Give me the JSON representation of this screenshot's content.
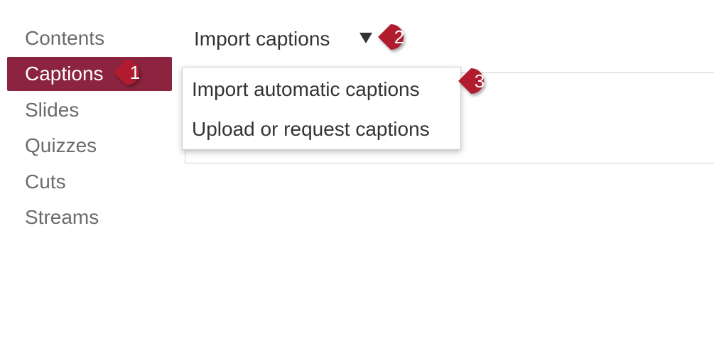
{
  "sidebar": {
    "items": [
      {
        "label": "Contents"
      },
      {
        "label": "Captions"
      },
      {
        "label": "Slides"
      },
      {
        "label": "Quizzes"
      },
      {
        "label": "Cuts"
      },
      {
        "label": "Streams"
      }
    ]
  },
  "header": {
    "import_label": "Import captions",
    "caret_icon": "caret-down-icon"
  },
  "dropdown": {
    "items": [
      {
        "label": "Import automatic captions"
      },
      {
        "label": "Upload or request captions"
      }
    ]
  },
  "callouts": [
    {
      "number": "1"
    },
    {
      "number": "2"
    },
    {
      "number": "3"
    }
  ],
  "colors": {
    "active_item": "#8c2440",
    "callout": "#b01c2e"
  }
}
